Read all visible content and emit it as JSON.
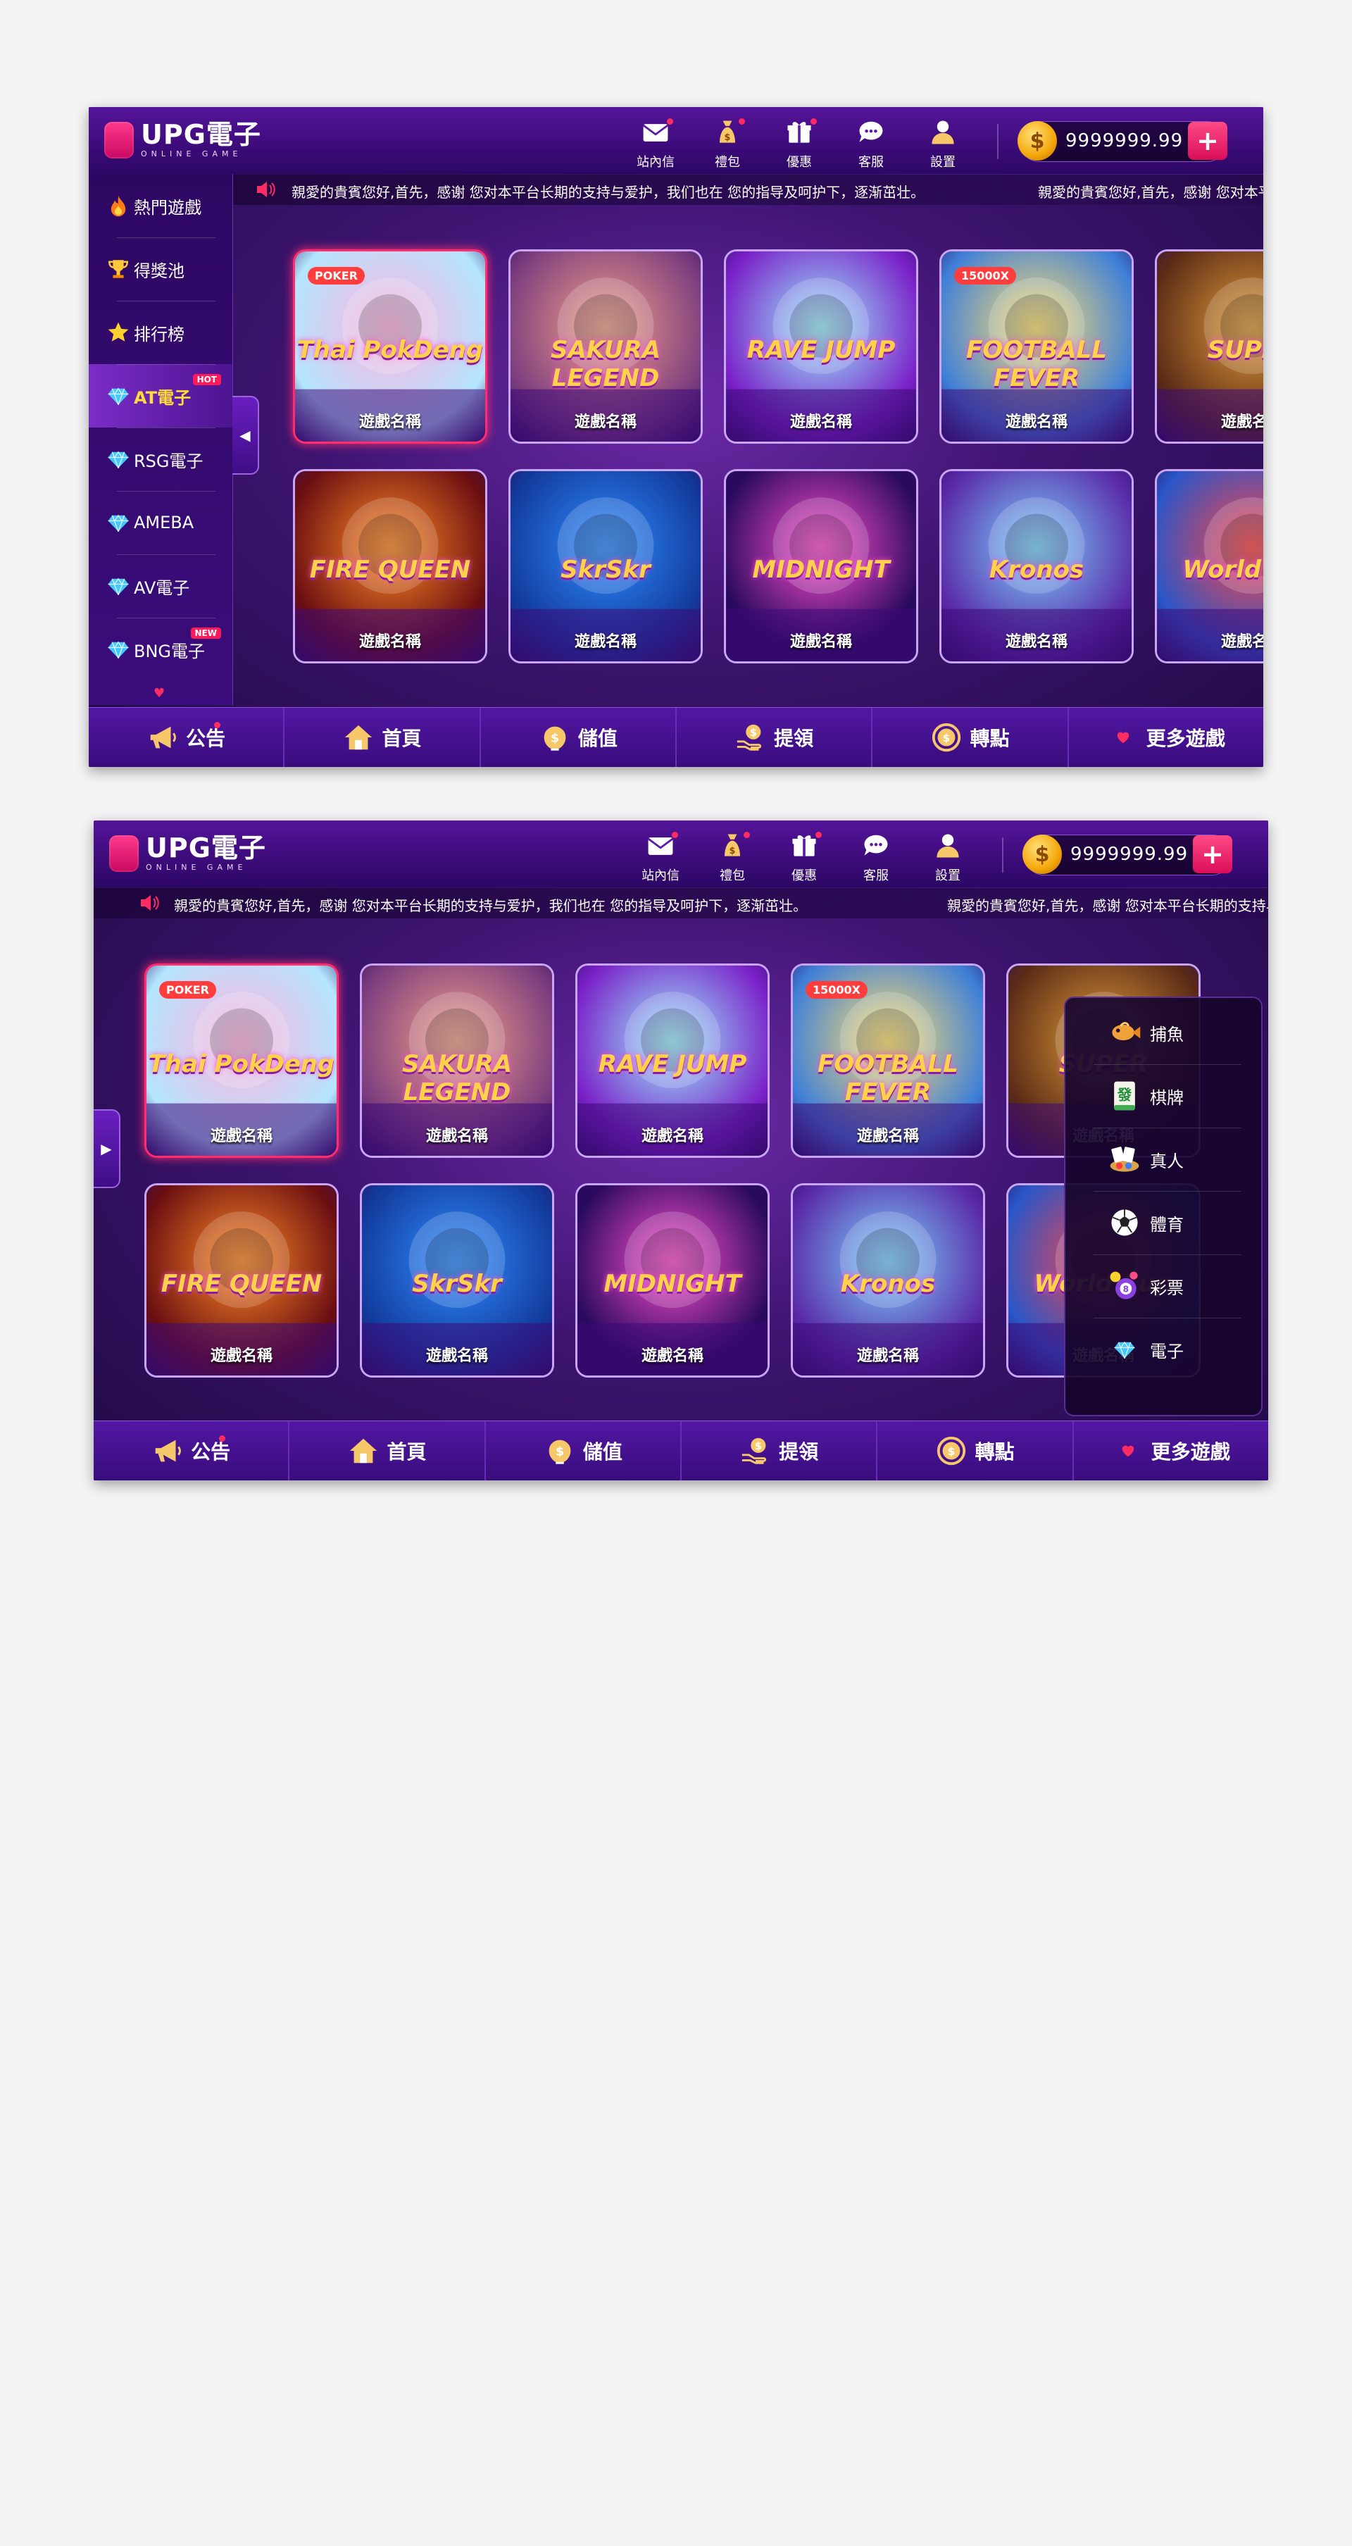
{
  "logo": {
    "main": "UPG電子",
    "sub": "ONLINE GAME"
  },
  "header_icons": [
    {
      "name": "mail-icon",
      "label": "站內信",
      "dot": true
    },
    {
      "name": "money-bag-icon",
      "label": "禮包",
      "dot": true
    },
    {
      "name": "gift-icon",
      "label": "優惠",
      "dot": true
    },
    {
      "name": "chat-icon",
      "label": "客服",
      "dot": false
    },
    {
      "name": "user-icon",
      "label": "設置",
      "dot": false
    }
  ],
  "balance": {
    "value": "9999999.99",
    "coin_symbol": "$",
    "add_label": "+"
  },
  "marquee": {
    "text": "親愛的貴賓您好,首先，感谢 您对本平台长期的支持与爱护，我们也在 您的指导及呵护下，逐渐茁壮。",
    "text_repeat": "親愛的貴賓您好,首先，感谢 您对本平台长期的支持与爱护，我们也在 您的指导及呵护下，逐渐茁壮。"
  },
  "sidebar": {
    "items": [
      {
        "name": "fire-icon",
        "label": "熱門遊戲",
        "badge": ""
      },
      {
        "name": "trophy-icon",
        "label": "得獎池",
        "badge": ""
      },
      {
        "name": "star-icon",
        "label": "排行榜",
        "badge": ""
      },
      {
        "name": "diamond-icon",
        "label": "AT電子",
        "badge": "HOT",
        "active": true
      },
      {
        "name": "diamond-icon",
        "label": "RSG電子",
        "badge": ""
      },
      {
        "name": "diamond-icon",
        "label": "AMEBA",
        "badge": ""
      },
      {
        "name": "diamond-icon",
        "label": "AV電子",
        "badge": ""
      },
      {
        "name": "diamond-icon",
        "label": "BNG電子",
        "badge": "NEW"
      }
    ],
    "more_indicator": "♥"
  },
  "collapse_arrow": {
    "left": "◀",
    "right": "▶"
  },
  "games": [
    {
      "title": "Thai PokDeng",
      "name_label": "遊戲名稱",
      "tag": "POKER",
      "palette": [
        "#ffb2dd",
        "#b4e6ff"
      ]
    },
    {
      "title": "SAKURA LEGEND",
      "name_label": "遊戲名稱",
      "tag": "",
      "palette": [
        "#f1a08a",
        "#7c3d7e"
      ]
    },
    {
      "title": "RAVE JUMP",
      "name_label": "遊戲名稱",
      "tag": "",
      "palette": [
        "#9ef0ff",
        "#7a21c8"
      ]
    },
    {
      "title": "FOOTBALL FEVER",
      "name_label": "遊戲名稱",
      "tag": "15000X",
      "palette": [
        "#ffe070",
        "#3f7fd8"
      ]
    },
    {
      "title": "SUPER",
      "name_label": "遊戲名稱",
      "tag": "",
      "palette": [
        "#e09b3a",
        "#5b2b16"
      ]
    },
    {
      "title": "FIRE QUEEN",
      "name_label": "遊戲名稱",
      "tag": "",
      "palette": [
        "#ff8a25",
        "#6b0e12"
      ]
    },
    {
      "title": "SkrSkr",
      "name_label": "遊戲名稱",
      "tag": "",
      "palette": [
        "#2e8cff",
        "#123a9b"
      ]
    },
    {
      "title": "MIDNIGHT",
      "name_label": "遊戲名稱",
      "tag": "",
      "palette": [
        "#ff4fd0",
        "#2a0a5e"
      ]
    },
    {
      "title": "Kronos",
      "name_label": "遊戲名稱",
      "tag": "",
      "palette": [
        "#7cd2ff",
        "#5a2aa8"
      ]
    },
    {
      "title": "World Cup",
      "name_label": "遊戲名稱",
      "tag": "",
      "palette": [
        "#ff4444",
        "#2a56c8"
      ]
    }
  ],
  "bottom_nav": [
    {
      "name": "megaphone-icon",
      "label": "公告",
      "dot": true
    },
    {
      "name": "home-icon",
      "label": "首頁",
      "dot": false
    },
    {
      "name": "deposit-icon",
      "label": "儲值",
      "dot": false
    },
    {
      "name": "withdraw-icon",
      "label": "提領",
      "dot": false
    },
    {
      "name": "transfer-icon",
      "label": "轉點",
      "dot": false
    },
    {
      "name": "heart-icon",
      "label": "更多遊戲",
      "dot": false
    }
  ],
  "more_games_popup": [
    {
      "name": "fish-icon",
      "label": "捕魚"
    },
    {
      "name": "mahjong-icon",
      "label": "棋牌"
    },
    {
      "name": "casino-icon",
      "label": "真人"
    },
    {
      "name": "soccer-icon",
      "label": "體育"
    },
    {
      "name": "lottery-icon",
      "label": "彩票"
    },
    {
      "name": "diamond-icon",
      "label": "電子"
    }
  ],
  "colors": {
    "accent": "#ff2b63",
    "brand": "#55149a",
    "highlight": "#ffdc3c"
  }
}
